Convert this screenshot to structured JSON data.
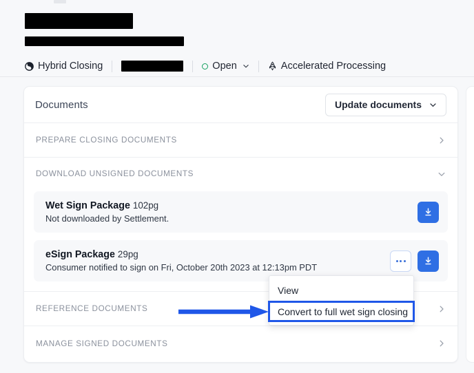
{
  "header": {
    "title_redacted": true,
    "subtitle_redacted": true,
    "meta": [
      {
        "label": "Hybrid Closing",
        "icon": "hybrid-closing-icon"
      },
      {
        "label": "",
        "icon": "",
        "redacted": true
      },
      {
        "label": "Open",
        "icon": "status-ring-icon",
        "color": "#14a05e",
        "has_chevron": true
      },
      {
        "label": "Accelerated Processing",
        "icon": "rocket-icon"
      }
    ]
  },
  "card": {
    "title": "Documents",
    "update_button": {
      "label": "Update documents",
      "chevron": "chevron-down-icon"
    },
    "sections": [
      {
        "id": "prepare-closing-documents",
        "label": "PREPARE CLOSING DOCUMENTS",
        "state": "collapsed",
        "chevron": "chevron-right-icon"
      },
      {
        "id": "download-unsigned-documents",
        "label": "DOWNLOAD UNSIGNED DOCUMENTS",
        "state": "expanded",
        "chevron": "chevron-down-icon"
      },
      {
        "id": "reference-documents",
        "label": "REFERENCE DOCUMENTS",
        "state": "collapsed",
        "chevron": "chevron-right-icon"
      },
      {
        "id": "manage-signed-documents",
        "label": "MANAGE SIGNED DOCUMENTS",
        "state": "collapsed",
        "chevron": "chevron-right-icon"
      }
    ],
    "packages": [
      {
        "name": "Wet Sign Package",
        "pages": "102pg",
        "status": "Not downloaded by Settlement.",
        "has_more": false,
        "download_label": "download-icon"
      },
      {
        "name": "eSign Package",
        "pages": "29pg",
        "status": "Consumer notified to sign on Fri, October 20th 2023 at 12:13pm PDT",
        "has_more": true,
        "download_label": "download-icon"
      }
    ]
  },
  "menu": {
    "items": [
      {
        "label": "View",
        "highlighted": false
      },
      {
        "label": "Convert to full wet sign closing",
        "highlighted": true
      }
    ]
  },
  "annotation": {
    "arrow_color": "#1f57e8",
    "highlight_color": "#1f57e8"
  },
  "colors": {
    "accent_blue": "#2f6fe4",
    "status_green": "#14a05e",
    "page_bg": "#f7f8fa",
    "card_bg": "#ffffff"
  }
}
